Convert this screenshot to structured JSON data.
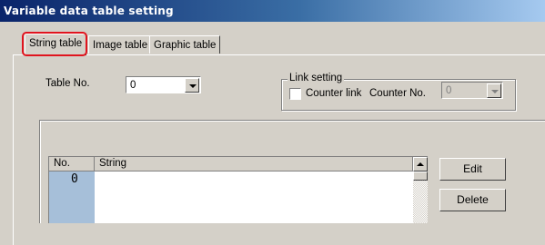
{
  "window": {
    "title": "Variable data table setting"
  },
  "tabs": [
    {
      "label": "String table",
      "active": true
    },
    {
      "label": "Image table",
      "active": false
    },
    {
      "label": "Graphic table",
      "active": false
    }
  ],
  "table_no": {
    "label": "Table No.",
    "value": "0"
  },
  "link_setting": {
    "legend": "Link setting",
    "counter_link_label": "Counter link",
    "counter_link_checked": false,
    "counter_no_label": "Counter No.",
    "counter_no_value": "0"
  },
  "list": {
    "columns": [
      "No.",
      "String"
    ],
    "rows": [
      {
        "no": "0",
        "string": ""
      }
    ]
  },
  "buttons": {
    "edit": "Edit",
    "delete": "Delete"
  },
  "colors": {
    "highlight_border": "#e0141e",
    "title_bar": "#0a246a",
    "selected_cell": "#a6bfd9"
  }
}
